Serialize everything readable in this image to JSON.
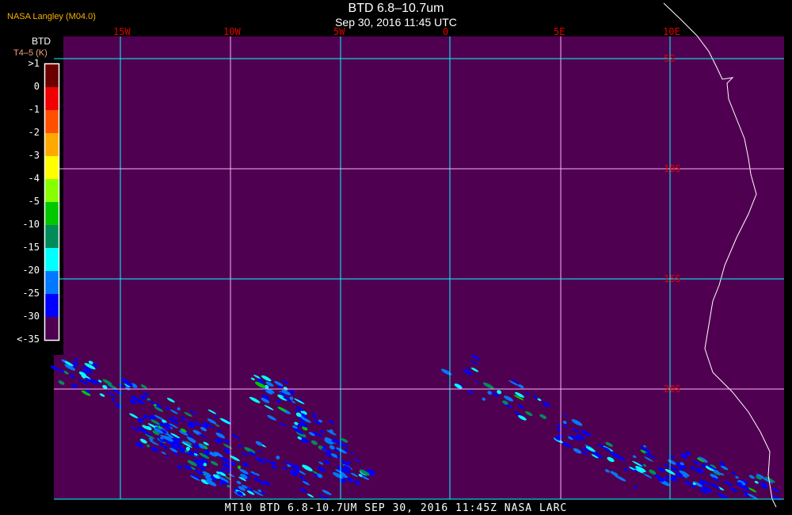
{
  "header": {
    "title": "BTD 6.8–10.7um",
    "subtitle": "Sep 30, 2016 11:45 UTC",
    "brand": "NASA Langley (M04.0)"
  },
  "legend": {
    "title": "BTD",
    "units": "T4–5 (K)",
    "entries": [
      {
        "label": ">1",
        "color": "#6a0000"
      },
      {
        "label": "0",
        "color": "#f00000"
      },
      {
        "label": "-1",
        "color": "#ff5000"
      },
      {
        "label": "-2",
        "color": "#ffa800"
      },
      {
        "label": "-3",
        "color": "#ffff00"
      },
      {
        "label": "-4",
        "color": "#88ff00"
      },
      {
        "label": "-5",
        "color": "#00c800"
      },
      {
        "label": "-10",
        "color": "#008c5a"
      },
      {
        "label": "-15",
        "color": "#00ffff"
      },
      {
        "label": "-20",
        "color": "#0078ff"
      },
      {
        "label": "-25",
        "color": "#0000ff"
      },
      {
        "label": "-30",
        "color": "#500050"
      },
      {
        "label": "<-35",
        "color": null
      }
    ]
  },
  "map": {
    "background_color": "#500050",
    "longitudes": [
      {
        "label": "15W",
        "color": "#00ffff"
      },
      {
        "label": "10W",
        "color": "#ffb0ff"
      },
      {
        "label": "5W",
        "color": "#00ffff"
      },
      {
        "label": "0",
        "color": "#00ffff"
      },
      {
        "label": "5E",
        "color": "#ffb0ff"
      },
      {
        "label": "10E",
        "color": "#00ffff"
      }
    ],
    "latitudes": [
      {
        "label": "5S",
        "color": "#00ffff"
      },
      {
        "label": "10S",
        "color": "#ffb0ff"
      },
      {
        "label": "15S",
        "color": "#00ffff"
      },
      {
        "label": "20S",
        "color": "#ffb0ff"
      }
    ]
  },
  "footer": "MT10  BTD 6.8-10.7UM   SEP 30, 2016 11:45Z   NASA LARC"
}
